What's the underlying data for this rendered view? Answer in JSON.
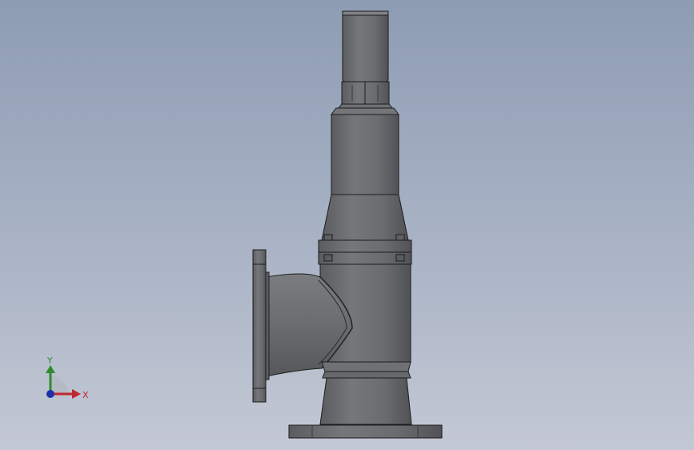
{
  "viewport": {
    "background_top": "#8e9cb3",
    "background_bottom": "#c3c8d4",
    "model": {
      "part": "safety-valve",
      "body_color": "#6b6d70",
      "edge_color": "#1c1c1c"
    }
  },
  "triad": {
    "x_label": "X",
    "y_label": "Y",
    "x_color": "#c0272d",
    "y_color": "#2e8b2e",
    "z_color": "#1f2fa8"
  }
}
